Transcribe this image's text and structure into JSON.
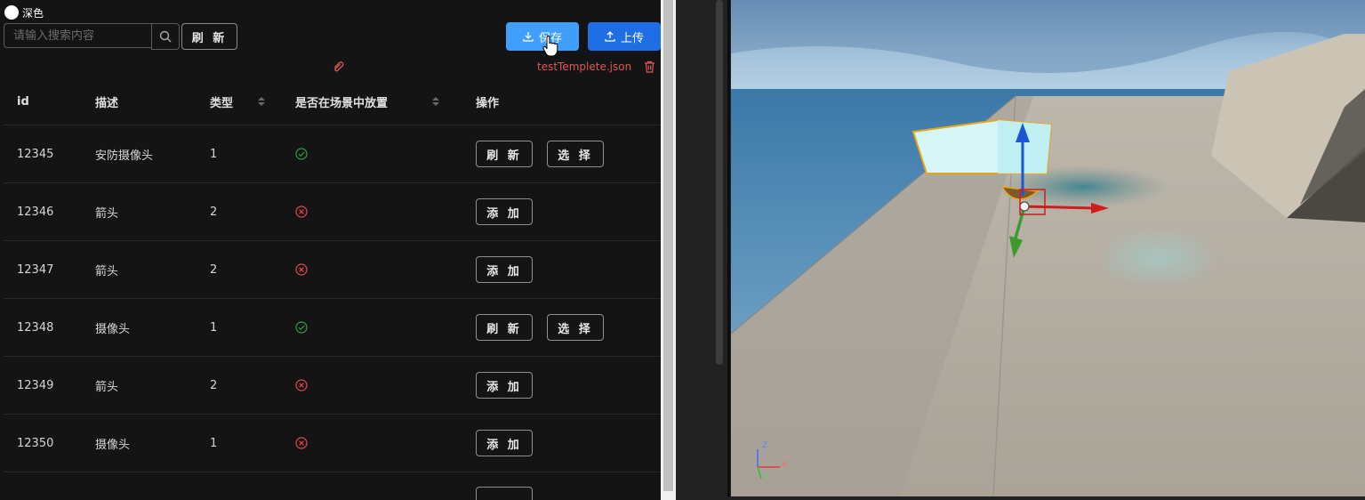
{
  "theme": {
    "label": "深色"
  },
  "toolbar": {
    "search_placeholder": "请输入搜索内容",
    "refresh_label": "刷 新",
    "save_label": "保存",
    "upload_label": "上传"
  },
  "file": {
    "name": "testTemplete.json"
  },
  "table": {
    "headers": {
      "id": "id",
      "desc": "描述",
      "type": "类型",
      "placed": "是否在场景中放置",
      "ops": "操作"
    },
    "rows": [
      {
        "id": "12345",
        "desc": "安防摄像头",
        "type": "1",
        "placed": true,
        "actions": [
          "刷 新",
          "选 择"
        ]
      },
      {
        "id": "12346",
        "desc": "箭头",
        "type": "2",
        "placed": false,
        "actions": [
          "添 加"
        ]
      },
      {
        "id": "12347",
        "desc": "箭头",
        "type": "2",
        "placed": false,
        "actions": [
          "添 加"
        ]
      },
      {
        "id": "12348",
        "desc": "摄像头",
        "type": "1",
        "placed": true,
        "actions": [
          "刷 新",
          "选 择"
        ]
      },
      {
        "id": "12349",
        "desc": "箭头",
        "type": "2",
        "placed": false,
        "actions": [
          "添 加"
        ]
      },
      {
        "id": "12350",
        "desc": "摄像头",
        "type": "1",
        "placed": false,
        "actions": [
          "添 加"
        ]
      }
    ]
  },
  "colors": {
    "primary": "#409eff",
    "upload": "#1e6ee6",
    "success": "#2ea043",
    "danger": "#e5484d",
    "file_text": "#e25555"
  },
  "viewport": {
    "axis_labels": {
      "x": "X",
      "y": "Y",
      "z": "Z"
    }
  }
}
